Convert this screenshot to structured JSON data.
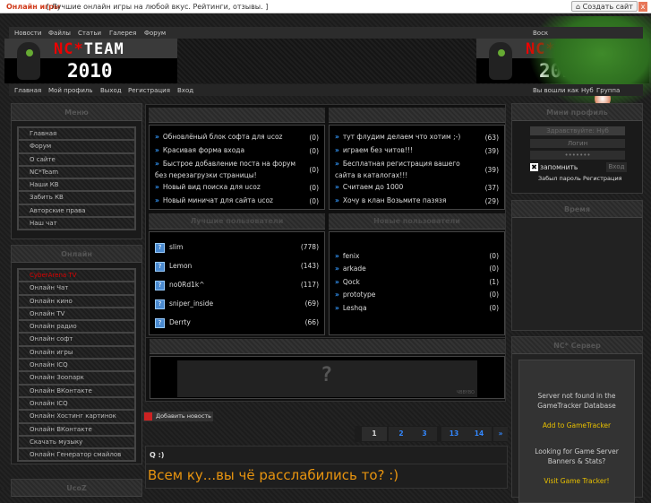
{
  "topbar": {
    "brand": "Онлайн игры",
    "slogan": "[ Лучшие онлайн игры на любой вкус. Рейтинги, отзывы. ]",
    "create_site": "Создать сайт",
    "close": "x"
  },
  "nav_top": {
    "items": [
      "Новости",
      "Файлы",
      "Статьи",
      "Галерея",
      "Форум"
    ],
    "right": "Воск"
  },
  "logo": {
    "name_a": "NC",
    "star": "*",
    "name_b": "TEAM",
    "year": "2010"
  },
  "nav_bottom": {
    "items": [
      "Главная",
      "Мой профиль",
      "Выход",
      "Регистрация",
      "Вход"
    ],
    "status": "Вы вошли как",
    "user": "Нуб",
    "group": "Группа"
  },
  "menu": {
    "title": "Меню",
    "items": [
      "Главная",
      "Форум",
      "О сайте",
      "NC*Team",
      "Наши КВ",
      "Забить КВ",
      "Авторские права",
      "Наш чат"
    ]
  },
  "online": {
    "title": "Онлайн",
    "items": [
      "CyberArena TV",
      "Онлайн Чат",
      "Онлайн кино",
      "Онлайн TV",
      "Онлайн радио",
      "Онлайн софт",
      "Онлайн игры",
      "Онлайн ICQ",
      "Онлайн Зоопарк",
      "Онлайн ВКонтакте",
      "Онлайн ICQ",
      "Онлайн Хостинг картинок",
      "Онлайн ВКонтакте",
      "Скачать музыку",
      "Онлайн Генератор смайлов"
    ]
  },
  "ucoz": {
    "title": "UcoZ"
  },
  "news": [
    {
      "text": "Обновлёный блок софта для ucoz",
      "count": "(0)"
    },
    {
      "text": "Красивая форма входа",
      "count": "(0)"
    },
    {
      "text": "Быстрое добавление поста на форум без перезагрузки страницы!",
      "count": "(0)"
    },
    {
      "text": "Новый вид поиска для ucoz",
      "count": "(0)"
    },
    {
      "text": "Новый миничат для сайта ucoz",
      "count": "(0)"
    }
  ],
  "forum": [
    {
      "text": "тут флудим делаем что хотим ;-)",
      "count": "(63)"
    },
    {
      "text": "играем без читов!!!",
      "count": "(39)"
    },
    {
      "text": "Бесплатная регистрация вашего сайта в каталогах!!!",
      "count": "(39)"
    },
    {
      "text": "Считаем до 1000",
      "count": "(37)"
    },
    {
      "text": "Хочу в клан Возьмите пазязя",
      "count": "(29)"
    }
  ],
  "best_users": {
    "title": "Лучшие пользователи",
    "items": [
      {
        "name": "slim",
        "count": "(778)"
      },
      {
        "name": "Lemon",
        "count": "(143)"
      },
      {
        "name": "no0Rd1k^",
        "count": "(117)"
      },
      {
        "name": "sniper_inside",
        "count": "(69)"
      },
      {
        "name": "Derrty",
        "count": "(66)"
      }
    ]
  },
  "new_users": {
    "title": "Новые пользователи",
    "items": [
      {
        "name": "fenix",
        "count": "(0)"
      },
      {
        "name": "arkade",
        "count": "(0)"
      },
      {
        "name": "Qock",
        "count": "(1)"
      },
      {
        "name": "prototype",
        "count": "(0)"
      },
      {
        "name": "Leshqa",
        "count": "(0)"
      }
    ]
  },
  "banner": {
    "mark": "?",
    "caption": "ЧВBYBO"
  },
  "add_news": "Добавить новость",
  "pagination": [
    "1",
    "2",
    "3",
    "13",
    "14",
    "»"
  ],
  "post": {
    "title": "Q :)",
    "text": "Всем ку...вы чё расслабились то? :)"
  },
  "profile": {
    "title": "Мини профиль",
    "greeting": "Здравствуйте: Нуб",
    "login_placeholder": "Логин",
    "password": "•••••••",
    "remember": "запомнить",
    "login_btn": "Вход",
    "forgot": "Забыл пароль",
    "sep": "·",
    "register": "Регистрация"
  },
  "time": {
    "title": "Время"
  },
  "server": {
    "title": "NC* Сервер",
    "msg": "Server not found in the GameTracker Database",
    "add": "Add to GameTracker",
    "looking": "Looking for Game Server Banners & Stats?",
    "visit": "Visit Game Tracker!"
  },
  "colors": {
    "accent": "#d03a1a",
    "link": "#3388ff",
    "post": "#e8940f",
    "gt": "#e8c000"
  }
}
